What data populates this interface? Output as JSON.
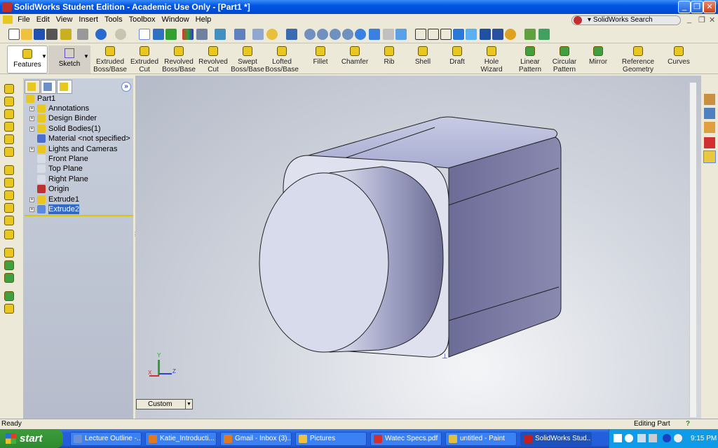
{
  "window": {
    "title": "SolidWorks Student Edition - Academic Use Only - [Part1 *]"
  },
  "menu": [
    "File",
    "Edit",
    "View",
    "Insert",
    "Tools",
    "Toolbox",
    "Window",
    "Help"
  ],
  "search": {
    "placeholder": "SolidWorks Search"
  },
  "command_manager": {
    "tabs": [
      {
        "label": "Features",
        "active": true
      },
      {
        "label": "Sketch",
        "active": false
      }
    ],
    "buttons": [
      {
        "label": "Extruded\nBoss/Base",
        "icon": "extruded-boss-icon"
      },
      {
        "label": "Extruded\nCut",
        "icon": "extruded-cut-icon"
      },
      {
        "label": "Revolved\nBoss/Base",
        "icon": "revolved-boss-icon"
      },
      {
        "label": "Revolved\nCut",
        "icon": "revolved-cut-icon"
      },
      {
        "label": "Swept\nBoss/Base",
        "icon": "swept-boss-icon"
      },
      {
        "label": "Lofted\nBoss/Base",
        "icon": "lofted-boss-icon"
      },
      {
        "label": "Fillet",
        "icon": "fillet-icon"
      },
      {
        "label": "Chamfer",
        "icon": "chamfer-icon"
      },
      {
        "label": "Rib",
        "icon": "rib-icon"
      },
      {
        "label": "Shell",
        "icon": "shell-icon"
      },
      {
        "label": "Draft",
        "icon": "draft-icon"
      },
      {
        "label": "Hole\nWizard",
        "icon": "hole-wizard-icon"
      },
      {
        "label": "Linear\nPattern",
        "icon": "linear-pattern-icon"
      },
      {
        "label": "Circular\nPattern",
        "icon": "circular-pattern-icon"
      },
      {
        "label": "Mirror",
        "icon": "mirror-icon"
      },
      {
        "label": "Reference\nGeometry",
        "icon": "reference-geometry-icon"
      },
      {
        "label": "Curves",
        "icon": "curves-icon"
      }
    ]
  },
  "feature_tree": {
    "root": "Part1",
    "items": [
      {
        "label": "Annotations",
        "expandable": true,
        "color": "#e8c820"
      },
      {
        "label": "Design Binder",
        "expandable": true,
        "color": "#e8c820"
      },
      {
        "label": "Solid Bodies(1)",
        "expandable": true,
        "color": "#e8c820"
      },
      {
        "label": "Material <not specified>",
        "expandable": false,
        "color": "#4a6fd0"
      },
      {
        "label": "Lights and Cameras",
        "expandable": true,
        "color": "#e8c820"
      },
      {
        "label": "Front Plane",
        "expandable": false,
        "color": "#d8dce6"
      },
      {
        "label": "Top Plane",
        "expandable": false,
        "color": "#d8dce6"
      },
      {
        "label": "Right Plane",
        "expandable": false,
        "color": "#d8dce6"
      },
      {
        "label": "Origin",
        "expandable": false,
        "color": "#c03030"
      },
      {
        "label": "Extrude1",
        "expandable": true,
        "color": "#e8c820"
      },
      {
        "label": "Extrude2",
        "expandable": true,
        "color": "#5a8ae0",
        "selected": true
      }
    ]
  },
  "viewport": {
    "view_dropdown": "Custom",
    "triad": {
      "x": "X",
      "y": "Y",
      "z": "Z"
    }
  },
  "status": {
    "left": "Ready",
    "mode": "Editing Part",
    "help": "?"
  },
  "taskbar": {
    "start": "start",
    "tasks": [
      {
        "label": "Lecture Outline -...",
        "color": "#6a8fd8"
      },
      {
        "label": "Katie_Introducti...",
        "color": "#e07a20"
      },
      {
        "label": "Gmail - Inbox (3)...",
        "color": "#e07a20"
      },
      {
        "label": "Pictures",
        "color": "#f0c040"
      },
      {
        "label": "Watec Specs.pdf",
        "color": "#d03030"
      },
      {
        "label": "untitled - Paint",
        "color": "#e0c040"
      },
      {
        "label": "SolidWorks Stud...",
        "color": "#c02020",
        "active": true
      }
    ],
    "clock": "9:15 PM"
  },
  "colors": {
    "accent": "#0055e5",
    "selection": "#3169c6"
  }
}
